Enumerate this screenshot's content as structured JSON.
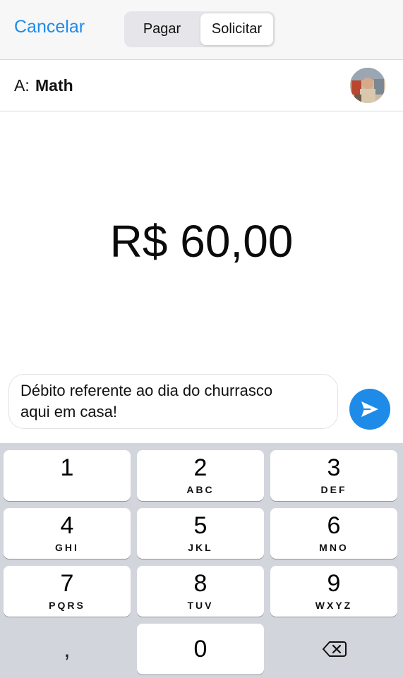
{
  "header": {
    "cancel_label": "Cancelar",
    "segments": {
      "pay": "Pagar",
      "request": "Solicitar",
      "selected": "Solicitar"
    }
  },
  "recipient": {
    "prefix": "A:",
    "name": "Math"
  },
  "amount": "R$ 60,00",
  "note": {
    "line1": "Débito referente ao dia do churrasco",
    "line2": "aqui em casa!"
  },
  "keypad": {
    "keys": [
      {
        "digit": "1",
        "letters": ""
      },
      {
        "digit": "2",
        "letters": "ABC"
      },
      {
        "digit": "3",
        "letters": "DEF"
      },
      {
        "digit": "4",
        "letters": "GHI"
      },
      {
        "digit": "5",
        "letters": "JKL"
      },
      {
        "digit": "6",
        "letters": "MNO"
      },
      {
        "digit": "7",
        "letters": "PQRS"
      },
      {
        "digit": "8",
        "letters": "TUV"
      },
      {
        "digit": "9",
        "letters": "WXYZ"
      },
      {
        "digit": "0",
        "letters": ""
      }
    ],
    "decimal": ","
  },
  "icons": {
    "send": "send-icon",
    "backspace": "backspace-icon",
    "avatar": "avatar"
  },
  "colors": {
    "accent": "#1f8be8",
    "keypad_bg": "#d2d5db"
  }
}
